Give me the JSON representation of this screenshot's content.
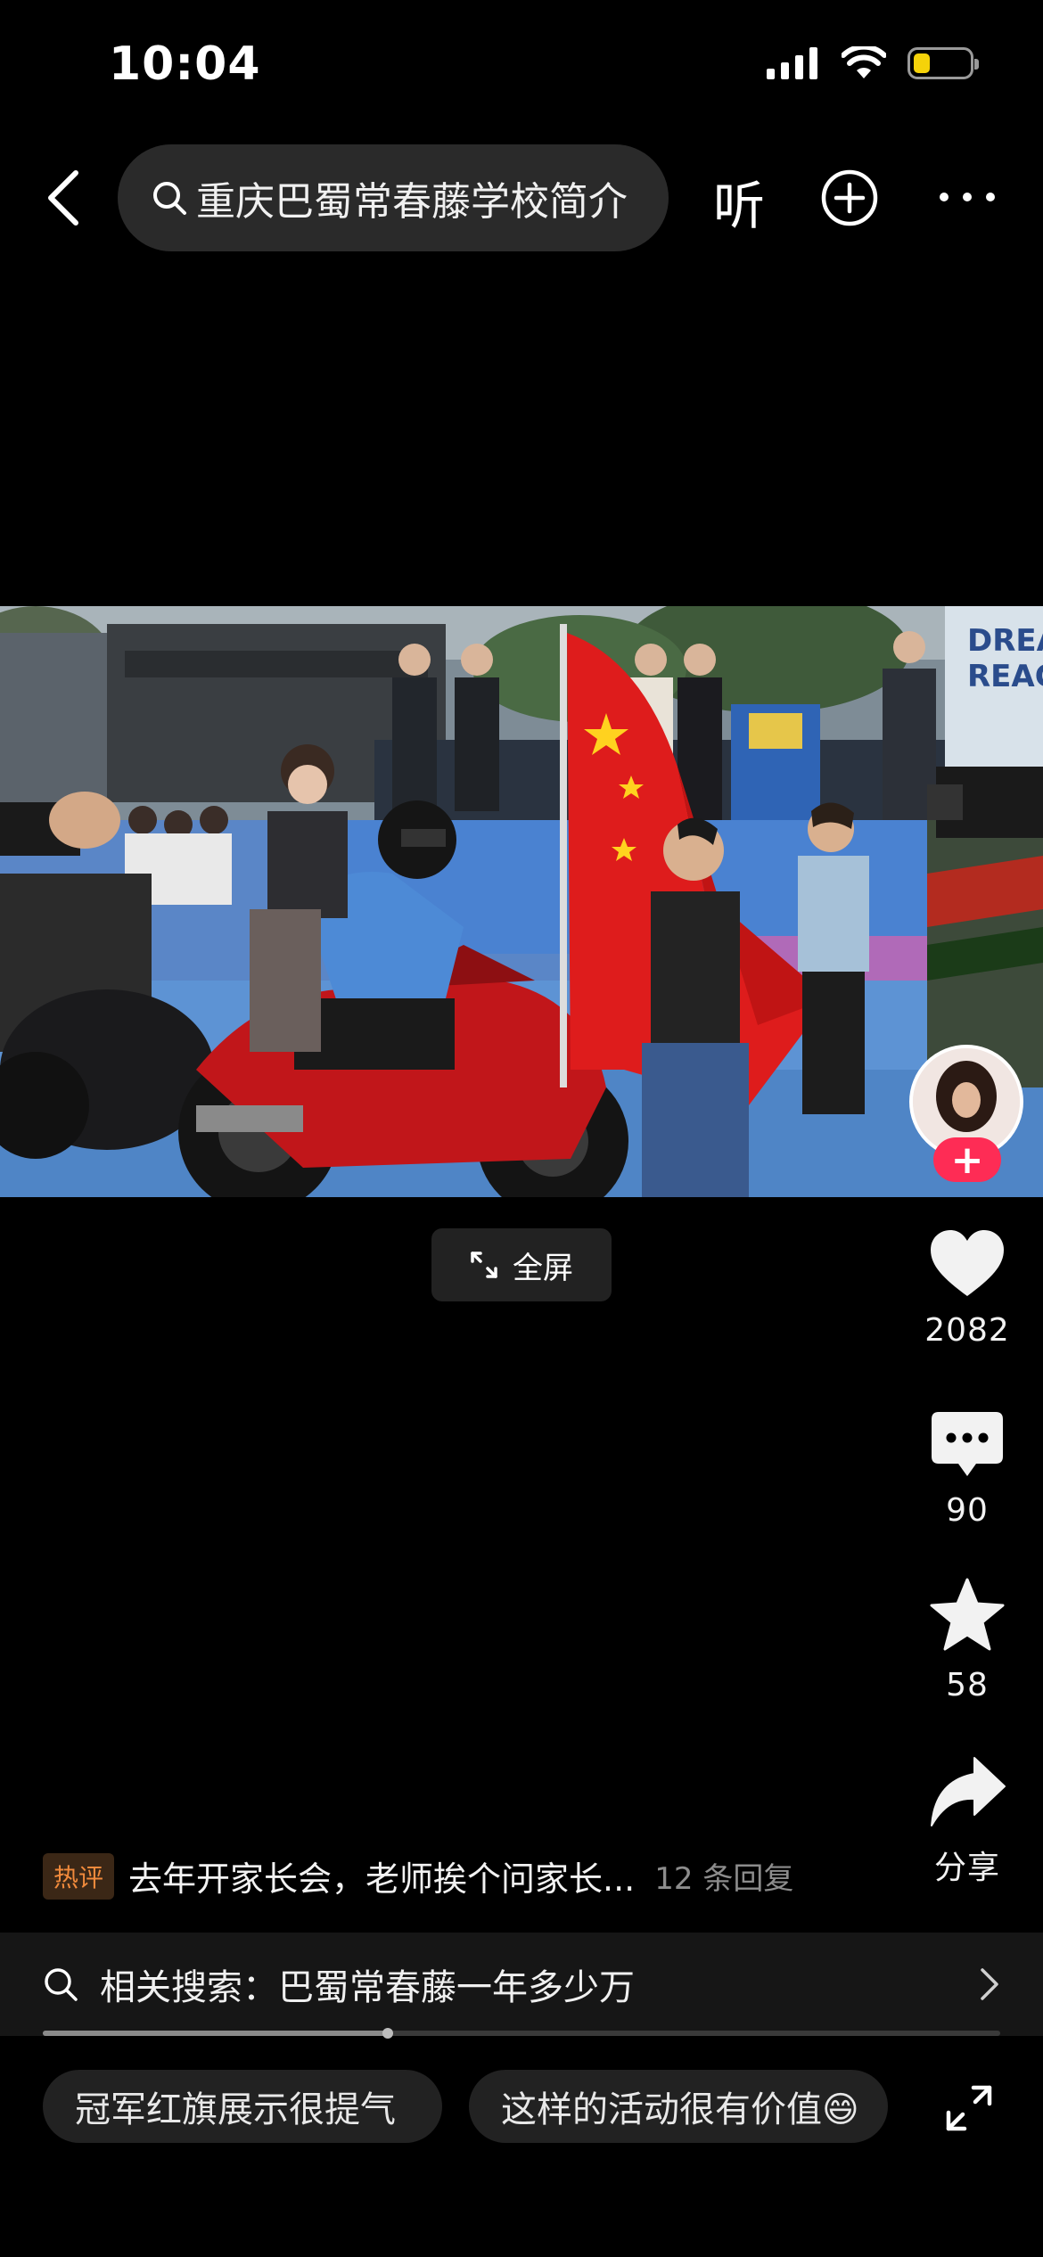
{
  "status_bar": {
    "time": "10:04",
    "battery_level": 0.3,
    "battery_color": "#f5d20a"
  },
  "top_bar": {
    "search_text": "重庆巴蜀常春藤学校简介",
    "listen_label": "听"
  },
  "video": {
    "banner_text": "DREA REAC",
    "fullscreen_label": "全屏"
  },
  "actions": {
    "likes": "2082",
    "comments": "90",
    "favorites": "58",
    "share_label": "分享"
  },
  "hot_comment": {
    "badge": "热评",
    "text": "去年开家长会，老师挨个问家长...",
    "replies": "12 条回复"
  },
  "related_search": {
    "label": "相关搜索：巴蜀常春藤一年多少万"
  },
  "playback": {
    "progress": 0.36
  },
  "quick_comments": [
    "冠军红旗展示很提气",
    "这样的活动很有价值😄"
  ],
  "colors": {
    "accent": "#fe2c55",
    "hot_badge": "#f08a3c",
    "background": "#000000"
  }
}
